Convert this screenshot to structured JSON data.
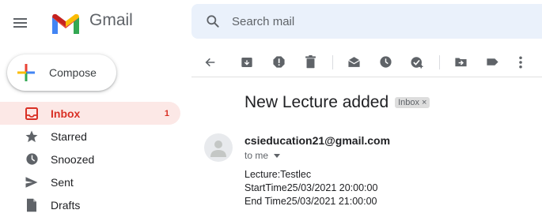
{
  "app": {
    "brand": "Gmail"
  },
  "search": {
    "placeholder": "Search mail"
  },
  "compose": {
    "label": "Compose"
  },
  "nav": [
    {
      "label": "Inbox",
      "count": "1",
      "icon": "inbox-icon",
      "active": true
    },
    {
      "label": "Starred",
      "count": "",
      "icon": "star-icon"
    },
    {
      "label": "Snoozed",
      "count": "",
      "icon": "clock-icon"
    },
    {
      "label": "Sent",
      "count": "",
      "icon": "send-icon"
    },
    {
      "label": "Drafts",
      "count": "",
      "icon": "draft-icon"
    }
  ],
  "toolbar": {
    "icons": [
      "back-arrow-icon",
      "archive-icon",
      "report-spam-icon",
      "delete-icon",
      "mark-unread-icon",
      "snooze-icon",
      "add-to-tasks-icon",
      "move-to-icon",
      "label-icon",
      "more-vert-icon"
    ]
  },
  "email": {
    "subject": "New Lecture added",
    "label_chip": "Inbox",
    "label_chip_close": "×",
    "sender": "csieducation21@gmail.com",
    "to": "to me",
    "body_lines": [
      "Lecture:Testlec",
      "StartTime25/03/2021 20:00:00",
      "End Time25/03/2021 21:00:00"
    ]
  },
  "colors": {
    "accent": "#d93025",
    "active_bg": "#fce8e6",
    "search_bg": "#eaf1fb",
    "icon": "#5f6368"
  }
}
